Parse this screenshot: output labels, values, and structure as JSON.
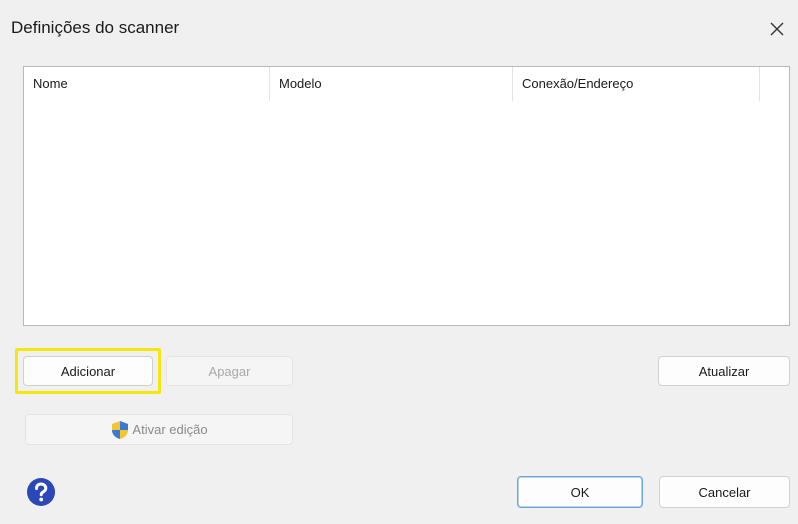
{
  "window": {
    "title": "Definições do scanner",
    "close_icon": "close-icon"
  },
  "scanner_list": {
    "columns": [
      "Nome",
      "Modelo",
      "Conexão/Endereço",
      ""
    ],
    "rows": []
  },
  "buttons": {
    "add": "Adicionar",
    "delete": "Apagar",
    "refresh": "Atualizar",
    "enable_edit": "Ativar edição",
    "ok": "OK",
    "cancel": "Cancelar"
  },
  "icons": {
    "shield": "uac-shield-icon",
    "help": "help-icon"
  },
  "colors": {
    "highlight": "#f5e70a",
    "help_blue": "#2b47b8"
  }
}
